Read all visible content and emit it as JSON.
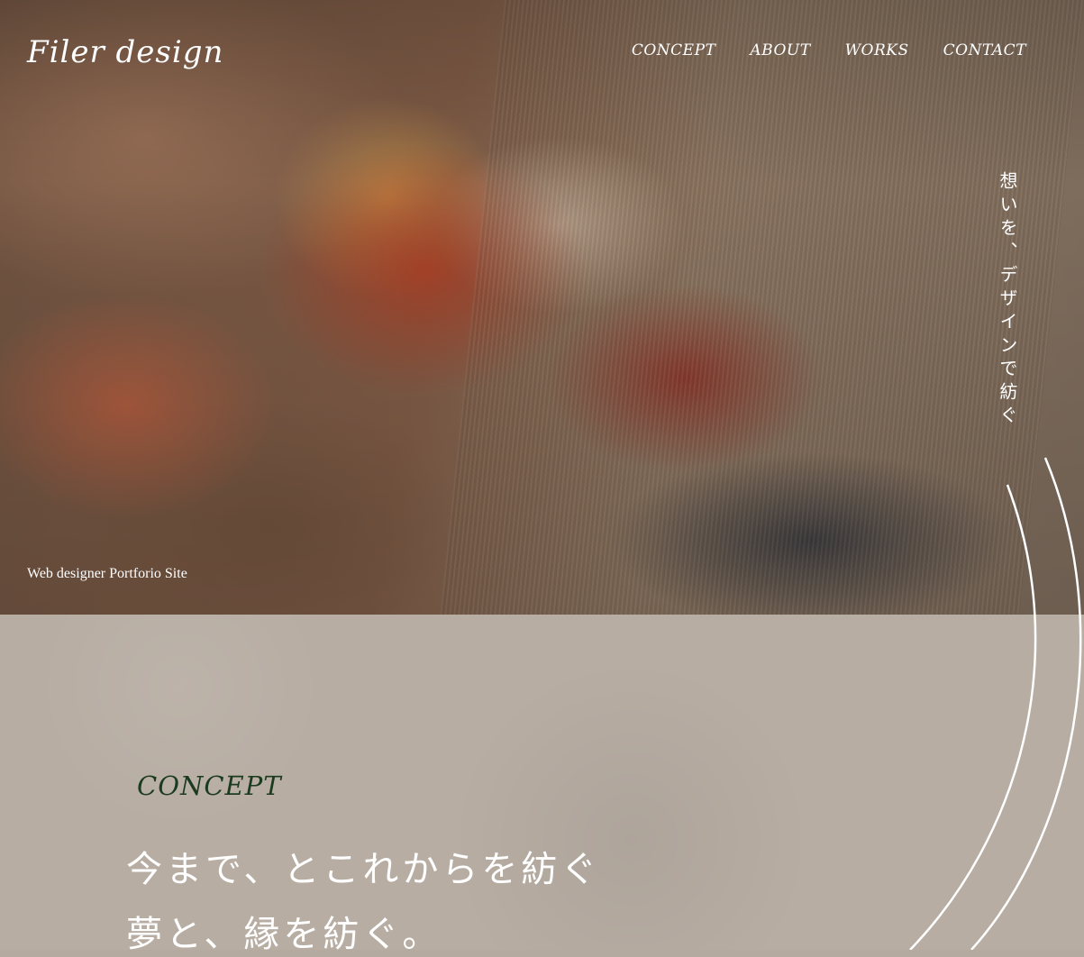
{
  "brand": {
    "logo": "Filer design"
  },
  "nav": {
    "items": [
      {
        "label": "CONCEPT"
      },
      {
        "label": "ABOUT"
      },
      {
        "label": "WORKS"
      },
      {
        "label": "CONTACT"
      }
    ]
  },
  "hero": {
    "vertical_copy": "想いを、デザインで紡ぐ",
    "tagline": "Web designer Portforio Site"
  },
  "concept": {
    "title": "CONCEPT",
    "lines": [
      "今まで、とこれからを紡ぐ",
      "夢と、縁を紡ぐ。"
    ]
  },
  "colors": {
    "title_green": "#1c3a1e",
    "content_bg": "#b7ada3",
    "text_white": "#ffffff"
  }
}
